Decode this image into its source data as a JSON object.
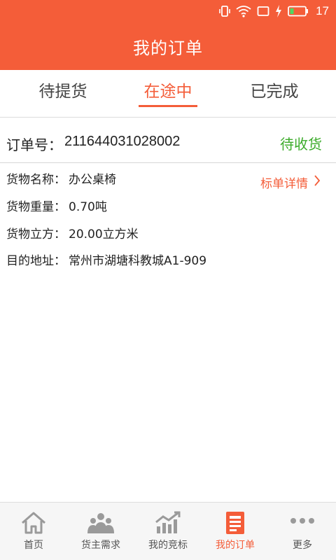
{
  "status_bar": {
    "time": "17"
  },
  "header": {
    "title": "我的订单"
  },
  "tabs": [
    {
      "label": "待提货",
      "active": false
    },
    {
      "label": "在途中",
      "active": true
    },
    {
      "label": "已完成",
      "active": false
    }
  ],
  "order": {
    "number_label": "订单号：",
    "number": "211644031028002",
    "status": "待收货",
    "detail_link": "标单详情",
    "fields": [
      {
        "label": "货物名称：",
        "value": "办公桌椅"
      },
      {
        "label": "货物重量：",
        "value": "0.70吨"
      },
      {
        "label": "货物立方：",
        "value": "20.00立方米"
      },
      {
        "label": "目的地址：",
        "value": "常州市湖塘科教城A1-909"
      }
    ]
  },
  "bottom_nav": [
    {
      "label": "首页",
      "icon": "home-icon",
      "active": false
    },
    {
      "label": "货主需求",
      "icon": "people-icon",
      "active": false
    },
    {
      "label": "我的竞标",
      "icon": "chart-icon",
      "active": false
    },
    {
      "label": "我的订单",
      "icon": "document-icon",
      "active": true
    },
    {
      "label": "更多",
      "icon": "more-icon",
      "active": false
    }
  ],
  "colors": {
    "accent": "#f45d39",
    "status_green": "#3bab2a",
    "nav_icon_gray": "#9a9a9a"
  }
}
